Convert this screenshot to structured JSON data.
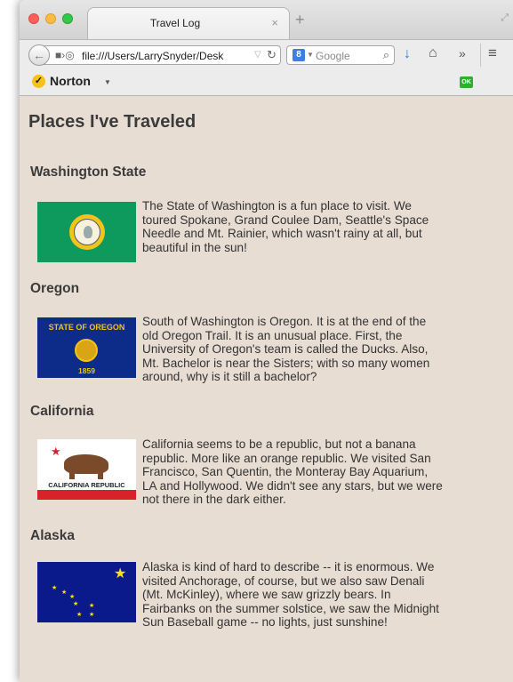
{
  "browser": {
    "tab_title": "Travel Log",
    "tab_close": "×",
    "new_tab": "+",
    "url": "file:///Users/LarrySnyder/Desk",
    "search_placeholder": "Google",
    "toolbar_name": "Norton",
    "ok_badge": "OK"
  },
  "page": {
    "title": "Places I've Traveled",
    "places": [
      {
        "name": "Washington State",
        "description": "The State of Washington is a fun place to visit. We toured Spokane, Grand Coulee Dam, Seattle's Space Needle and Mt. Rainier, which wasn't rainy at all, but beautiful in the sun!"
      },
      {
        "name": "Oregon",
        "description": "South of Washington is Oregon. It is at the end of the old Oregon Trail. It is an unusual place. First, the University of Oregon's team is called the Ducks. Also, Mt. Bachelor is near the Sisters; with so many women around, why is it still a bachelor?",
        "flag_top_text": "STATE OF OREGON",
        "flag_bottom_text": "1859"
      },
      {
        "name": "California",
        "description": "California seems to be a republic, but not a banana republic. More like an orange republic. We visited San Francisco, San Quentin, the Monteray Bay Aquarium, LA and Hollywood. We didn't see any stars, but we were not there in the dark either.",
        "flag_text": "CALIFORNIA REPUBLIC"
      },
      {
        "name": "Alaska",
        "description": "Alaska is kind of hard to describe -- it is enormous. We visited Anchorage, of course, but we also saw Denali (Mt. McKinley), where we saw grizzly bears. In Fairbanks on the summer solstice, we saw the Midnight Sun Baseball game -- no lights, just sunshine!"
      }
    ]
  },
  "colors": {
    "page_background": "#e8ddd3",
    "washington_flag": "#0e9a5c",
    "oregon_flag": "#0d2b88",
    "california_stripe": "#d7222a",
    "alaska_flag": "#0b1a8a",
    "star_gold": "#ffdf1a"
  },
  "icons": [
    "back-arrow-icon",
    "bookmarks-icon",
    "globe-icon",
    "reload-icon",
    "search-icon",
    "download-icon",
    "home-icon",
    "overflow-icon",
    "menu-icon",
    "norton-check-icon"
  ]
}
